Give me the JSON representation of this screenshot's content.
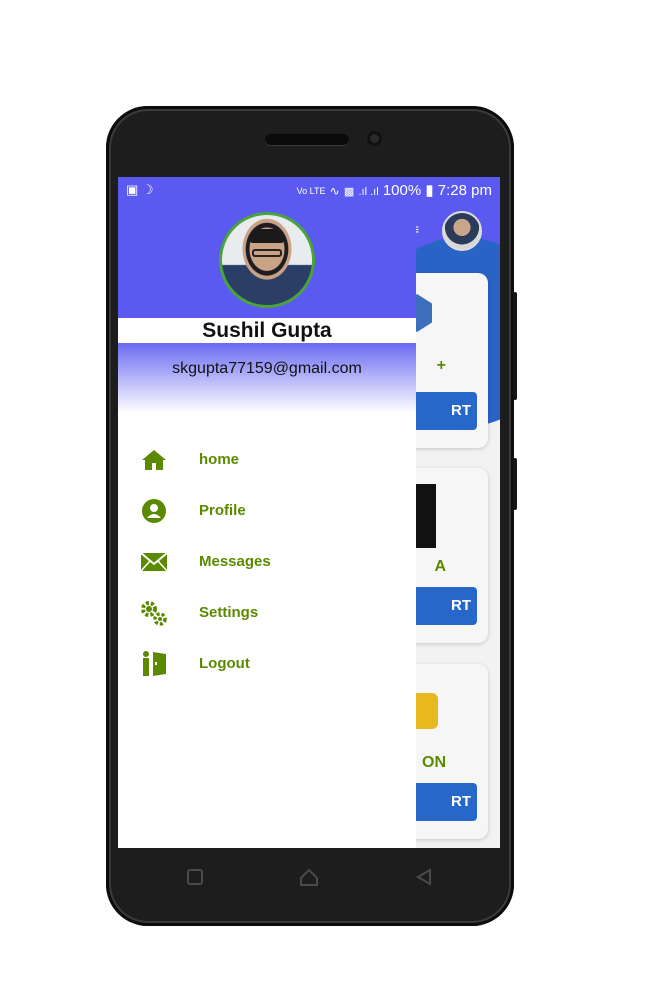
{
  "status_bar": {
    "left_icons": [
      "image-icon",
      "moon-icon"
    ],
    "volte": "Vo LTE",
    "battery_percent": "100%",
    "time": "7:28 pm"
  },
  "drawer": {
    "user_name": "Sushil Gupta",
    "user_email": "skgupta77159@gmail.com",
    "menu": [
      {
        "label": "home",
        "icon": "home-icon"
      },
      {
        "label": "Profile",
        "icon": "profile-icon"
      },
      {
        "label": "Messages",
        "icon": "envelope-icon"
      },
      {
        "label": "Settings",
        "icon": "gears-icon"
      },
      {
        "label": "Logout",
        "icon": "exit-door-icon"
      }
    ]
  },
  "background_app": {
    "cards": [
      {
        "lang_fragment": "+",
        "button_fragment": "RT"
      },
      {
        "lang_fragment": "A",
        "button_fragment": "RT"
      },
      {
        "lang_fragment": "ON",
        "button_fragment": "RT"
      }
    ]
  },
  "colors": {
    "accent": "#5a5af0",
    "menu_green": "#5b8a00",
    "button_blue": "#2667c9"
  }
}
